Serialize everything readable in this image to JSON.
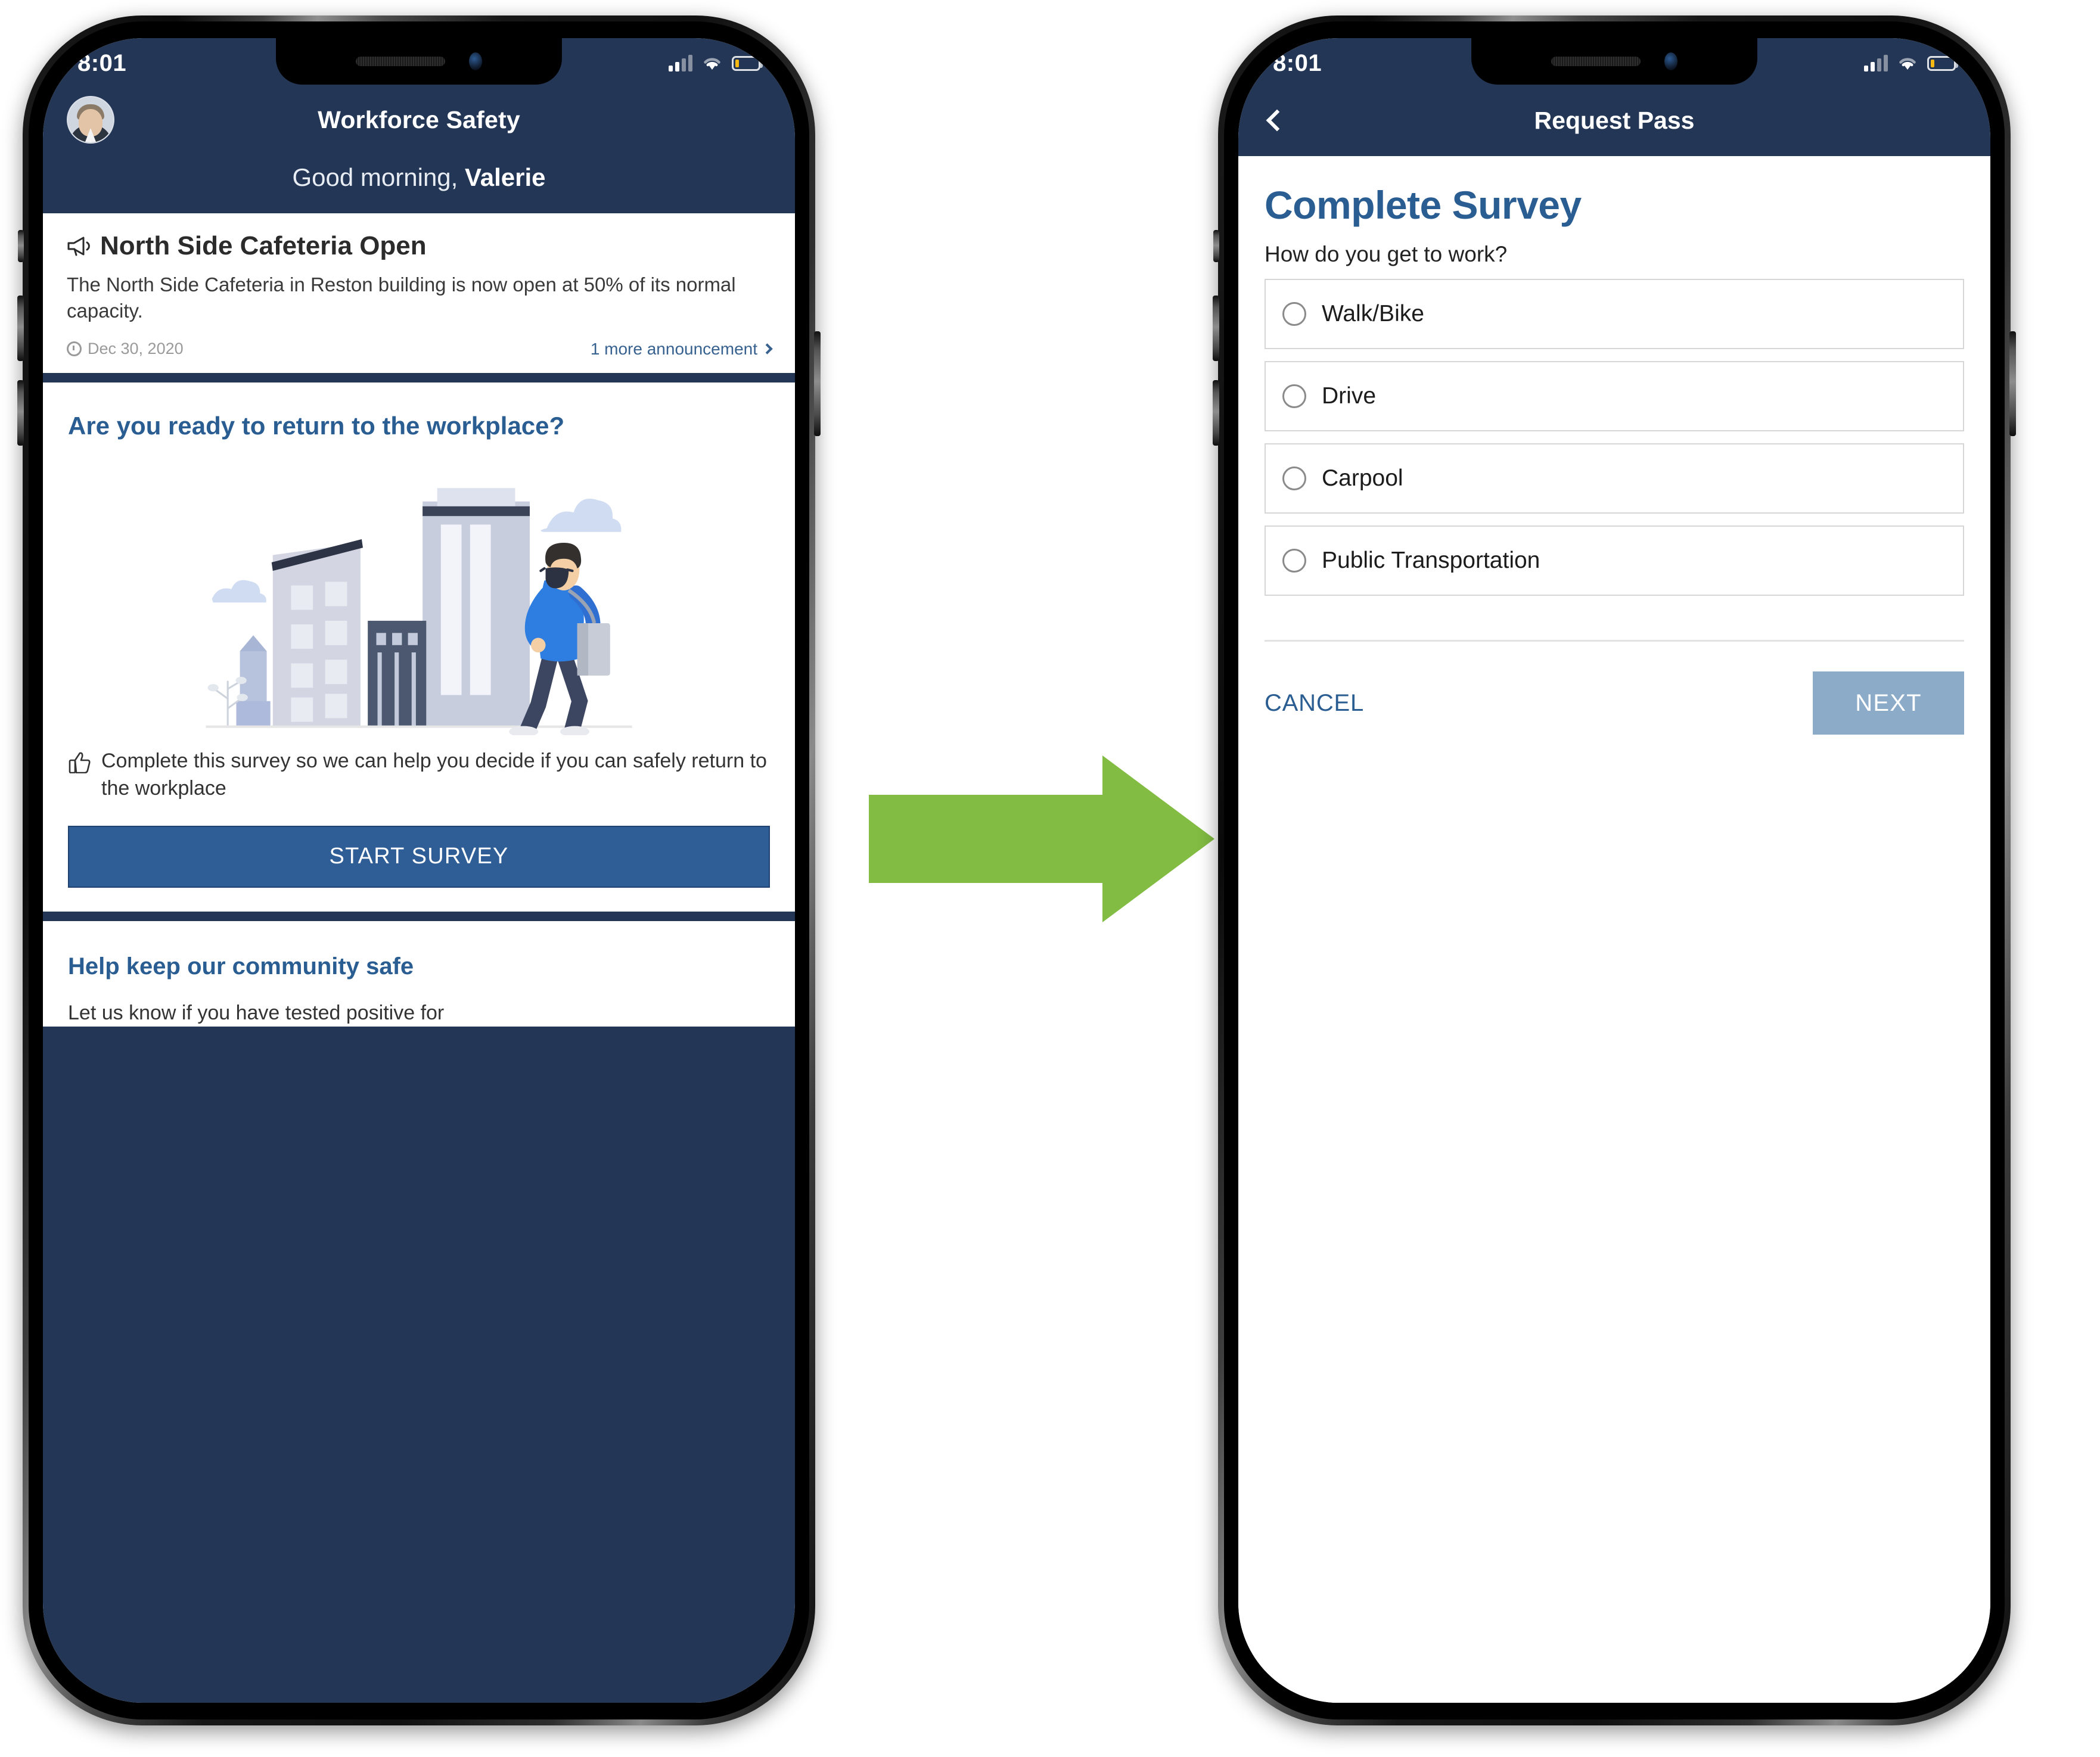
{
  "colors": {
    "navy": "#233655",
    "brand_blue": "#2a5d92",
    "button_blue": "#2f5e96",
    "next_blue": "#8cabc9",
    "arrow_green": "#82bc42",
    "battery_amber": "#f5b912"
  },
  "left_phone": {
    "status": {
      "time": "8:01",
      "signal": "signal-bars",
      "wifi": "wifi-icon",
      "battery": "battery-icon"
    },
    "header": {
      "app_title": "Workforce Safety",
      "avatar": "user-avatar",
      "greeting_prefix": "Good morning, ",
      "greeting_name": "Valerie"
    },
    "announcement": {
      "icon": "megaphone-icon",
      "title": "North Side Cafeteria Open",
      "body": "The North Side Cafeteria in Reston building is now open at 50% of its normal capacity.",
      "date": "Dec 30, 2020",
      "more_link": "1 more announcement"
    },
    "survey_card": {
      "heading": "Are you ready to return to the workplace?",
      "illustration": "city-worker-illustration",
      "copy_icon": "thumbs-up-icon",
      "copy": "Complete this survey so we can help you decide if you can safely return to the workplace",
      "button": "START SURVEY"
    },
    "community_card": {
      "heading": "Help keep our community safe",
      "body": "Let us know if you have tested positive for"
    }
  },
  "right_phone": {
    "status": {
      "time": "8:01",
      "signal": "signal-bars",
      "wifi": "wifi-icon",
      "battery": "battery-icon"
    },
    "nav": {
      "back": "back-chevron",
      "title": "Request Pass"
    },
    "page": {
      "title": "Complete Survey",
      "question": "How do you get to work?",
      "options": [
        {
          "label": "Walk/Bike",
          "selected": false
        },
        {
          "label": "Drive",
          "selected": false
        },
        {
          "label": "Carpool",
          "selected": false
        },
        {
          "label": "Public Transportation",
          "selected": false
        }
      ],
      "cancel": "CANCEL",
      "next": "NEXT"
    }
  },
  "flow": {
    "arrow": "right-arrow"
  }
}
